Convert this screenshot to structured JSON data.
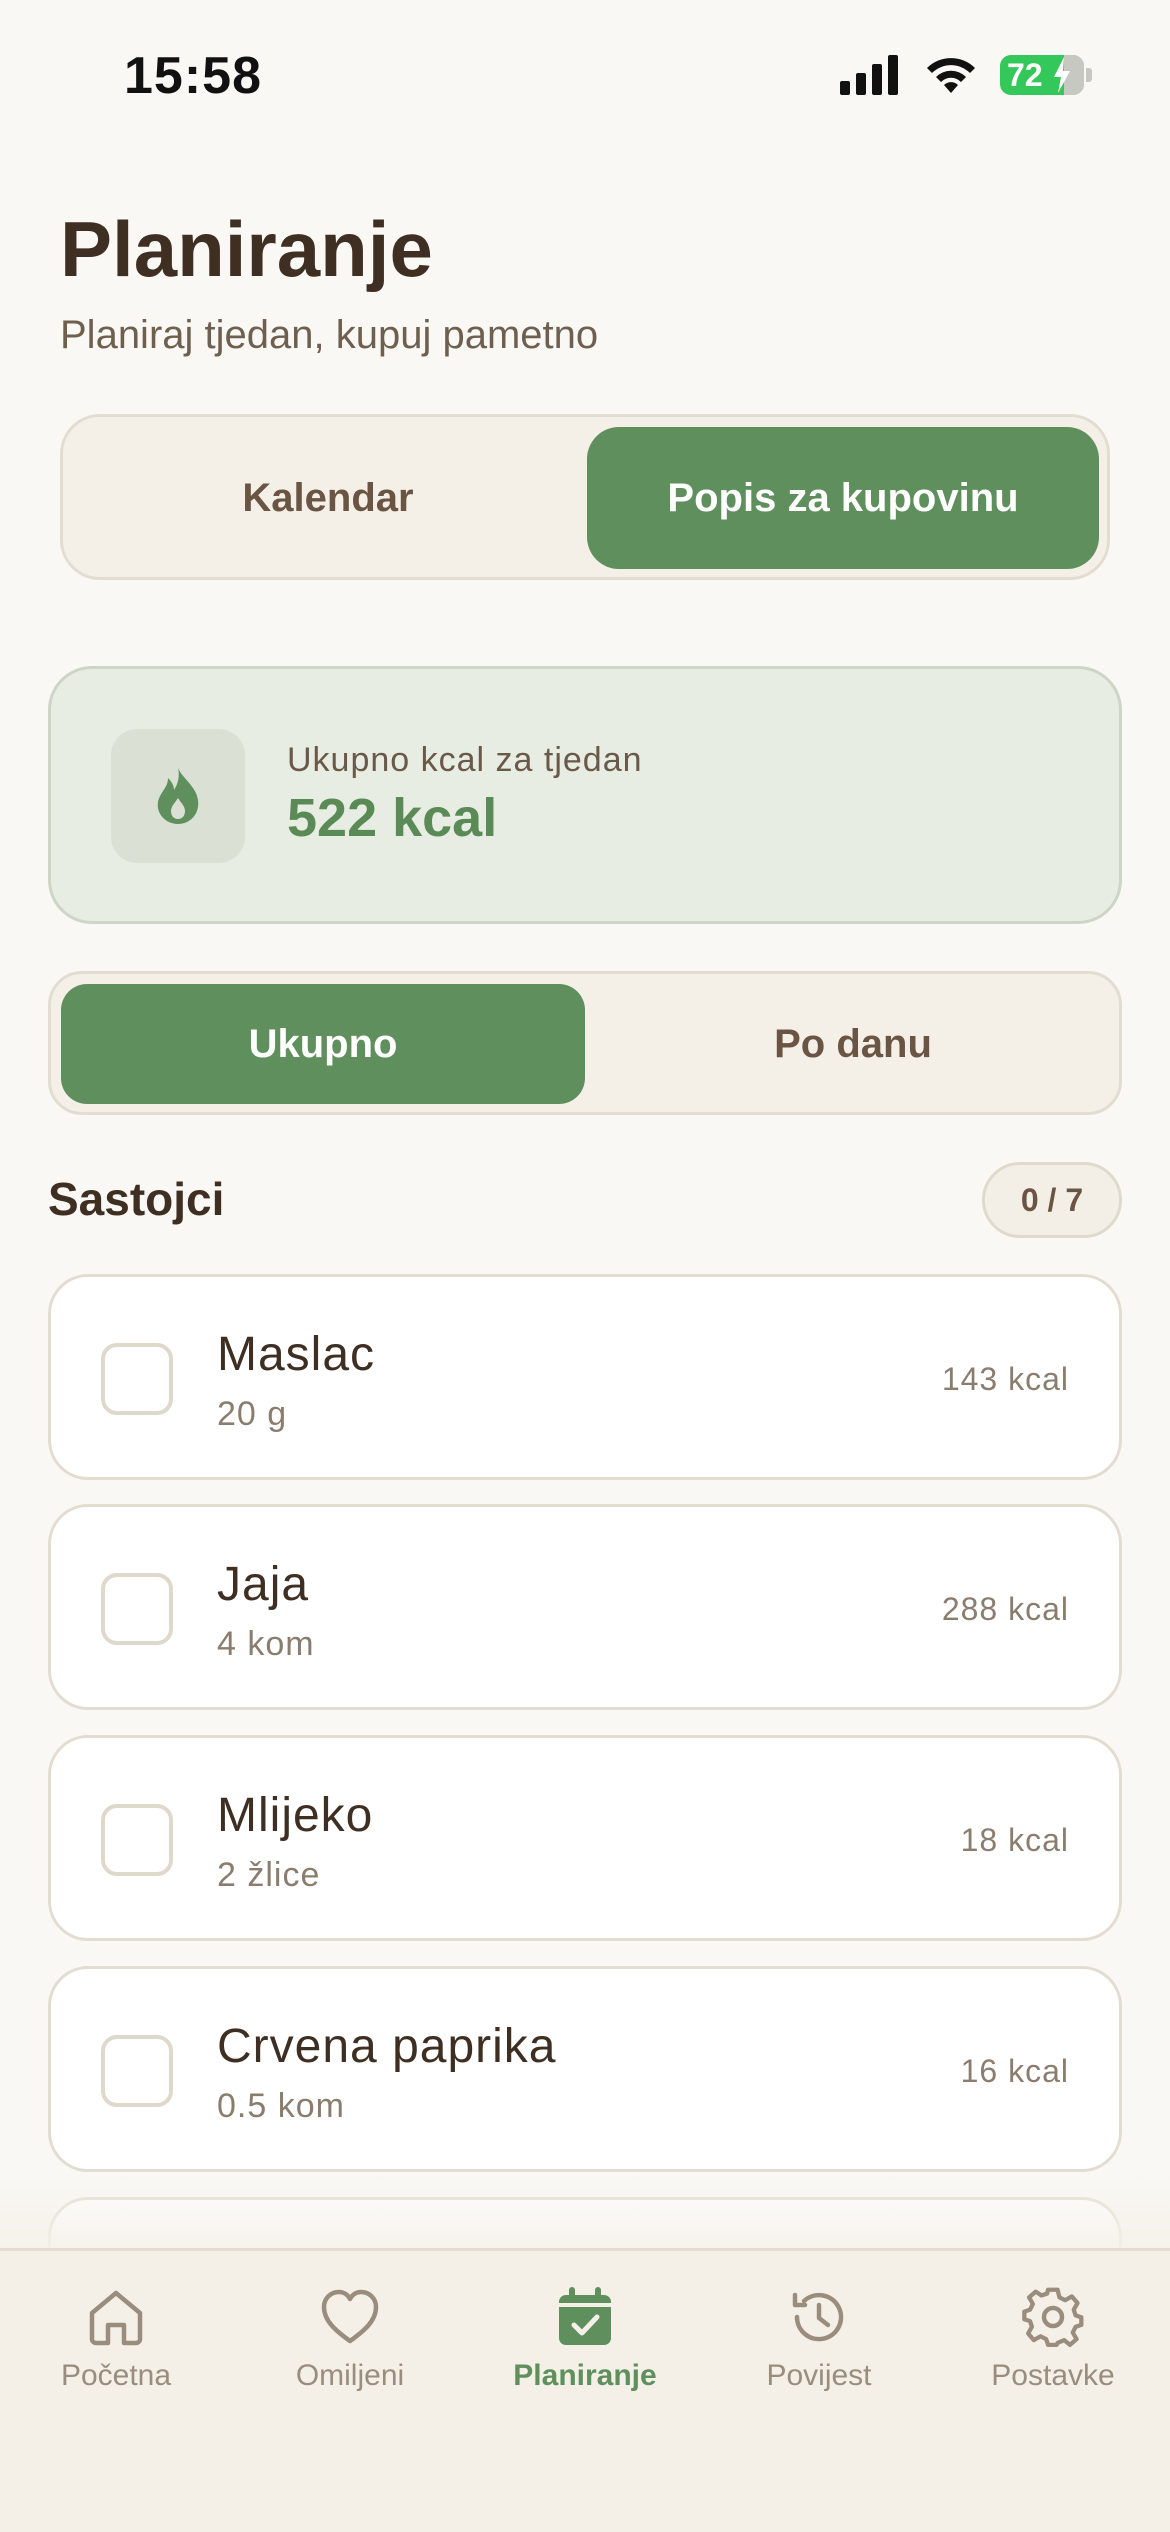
{
  "status_bar": {
    "time": "15:58",
    "battery": "72"
  },
  "header": {
    "title": "Planiranje",
    "subtitle": "Planiraj tjedan, kupuj pametno"
  },
  "view_toggle": {
    "calendar_label": "Kalendar",
    "shopping_label": "Popis za kupovinu",
    "selected": "Popis za kupovinu"
  },
  "kcal_summary": {
    "label": "Ukupno kcal za tjedan",
    "value": "522 kcal",
    "icon": "flame-icon"
  },
  "grouping_toggle": {
    "total_label": "Ukupno",
    "by_day_label": "Po danu",
    "selected": "Ukupno"
  },
  "ingredients": {
    "title": "Sastojci",
    "count": "0 / 7",
    "items": [
      {
        "name": "Maslac",
        "qty": "20 g",
        "kcal": "143 kcal",
        "checked": false
      },
      {
        "name": "Jaja",
        "qty": "4 kom",
        "kcal": "288 kcal",
        "checked": false
      },
      {
        "name": "Mlijeko",
        "qty": "2 žlice",
        "kcal": "18 kcal",
        "checked": false
      },
      {
        "name": "Crvena paprika",
        "qty": "0.5 kom",
        "kcal": "16 kcal",
        "checked": false
      }
    ]
  },
  "tab_bar": {
    "tabs": [
      {
        "label": "Početna",
        "icon": "home-icon"
      },
      {
        "label": "Omiljeni",
        "icon": "heart-icon"
      },
      {
        "label": "Planiranje",
        "icon": "calendar-check-icon",
        "active": true
      },
      {
        "label": "Povijest",
        "icon": "history-icon"
      },
      {
        "label": "Postavke",
        "icon": "gear-icon"
      }
    ]
  },
  "colors": {
    "accent": "#5f8f5c",
    "background": "#f9f8f4",
    "text": "#3f2f22"
  }
}
